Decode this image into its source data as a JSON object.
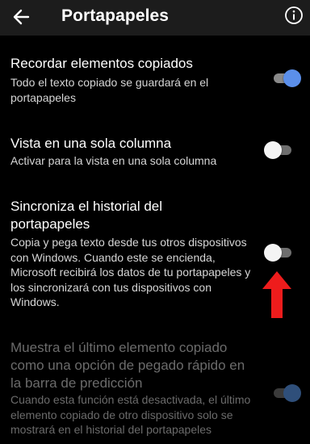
{
  "header": {
    "title": "Portapapeles",
    "back_icon": "arrow-left-icon",
    "info_icon": "info-circle-icon"
  },
  "settings": [
    {
      "label": "Recordar elementos copiados",
      "description": "Todo el texto copiado se guardará en el portapapeles",
      "toggle": "on",
      "enabled": true
    },
    {
      "label": "Vista en una sola columna",
      "description": "Activar para la vista en una sola columna",
      "toggle": "off",
      "enabled": true
    },
    {
      "label": "Sincroniza el historial del portapapeles",
      "description": "Copia y pega texto desde tus otros dispositivos con Windows. Cuando este se encienda, Microsoft recibirá los datos de tu portapapeles y los sincronizará con tus dispositivos con Windows.",
      "toggle": "off",
      "enabled": true
    },
    {
      "label": "Muestra el último elemento copiado como una opción de pegado rápido en la barra de predicción",
      "description": "Cuando esta función está desactivada, el último elemento copiado de otro dispositivo solo se mostrará en el historial del portapapeles",
      "toggle": "on",
      "enabled": false
    }
  ],
  "annotation": {
    "arrow_icon": "red-arrow-up-icon",
    "color": "#ee1c1c"
  },
  "colors": {
    "background": "#000000",
    "appbar": "#1c1c1c",
    "toggle_on": "#5b8fea"
  }
}
